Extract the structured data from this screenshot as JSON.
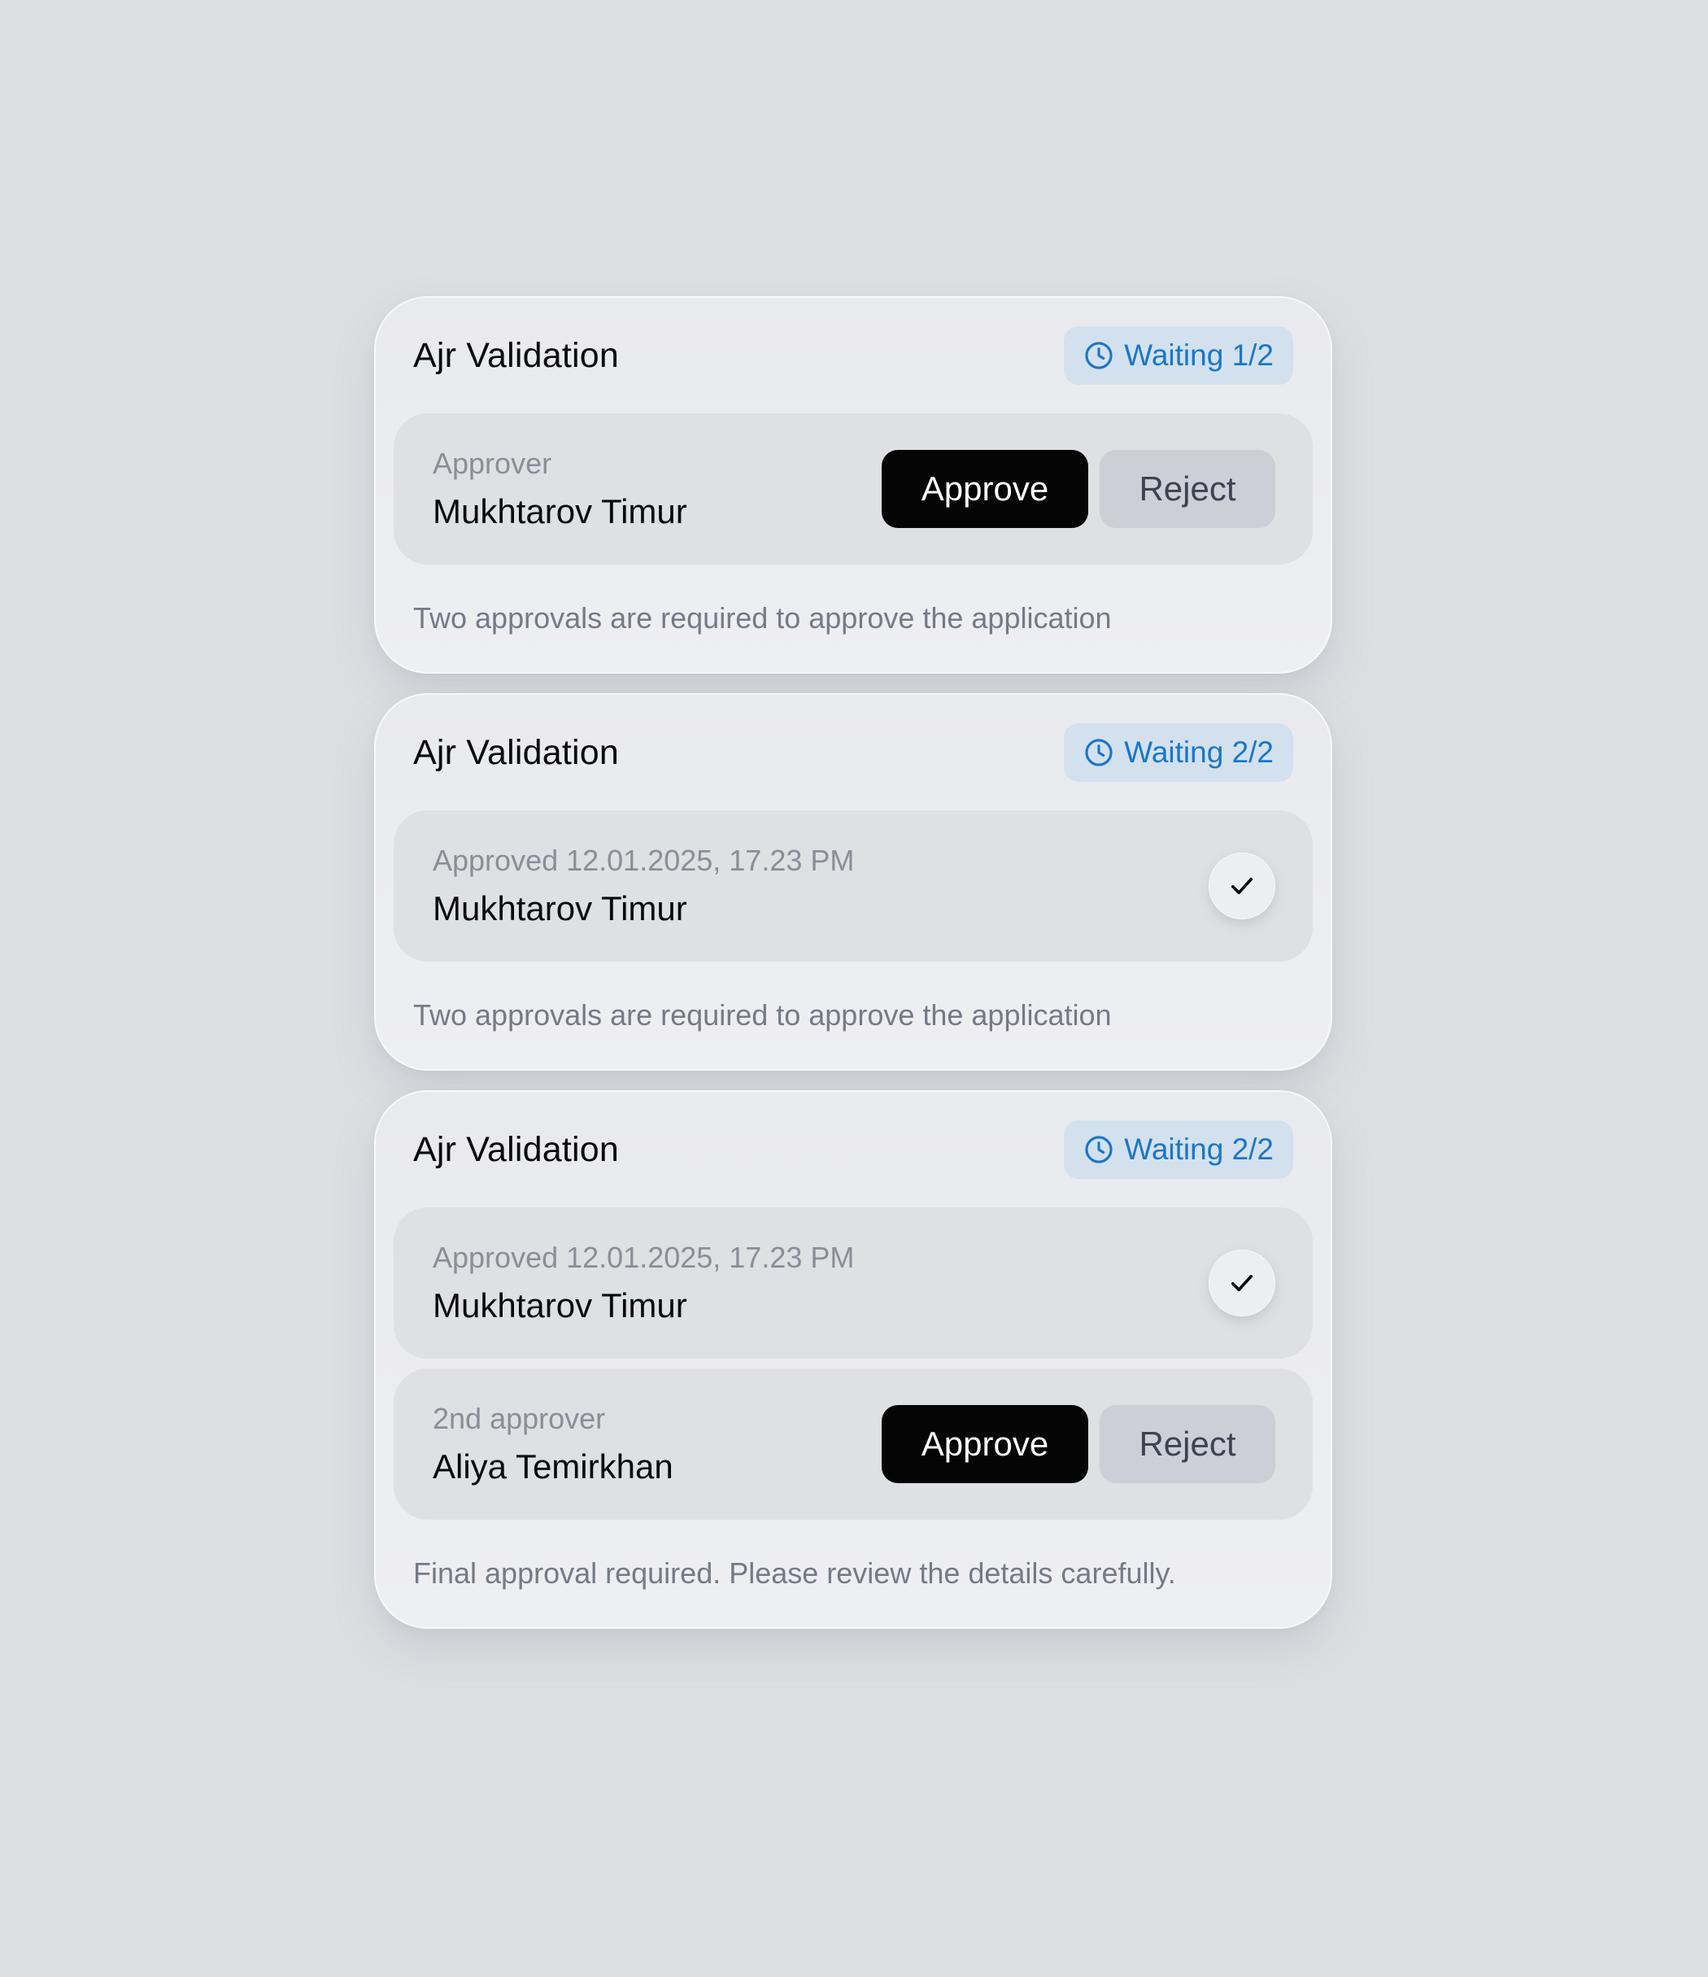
{
  "cards": [
    {
      "title": "Ajr Validation",
      "status": "Waiting 1/2",
      "rows": [
        {
          "caption": "Approver",
          "name": "Mukhtarov Timur",
          "approve_label": "Approve",
          "reject_label": "Reject"
        }
      ],
      "note": "Two approvals are required to approve the application"
    },
    {
      "title": "Ajr Validation",
      "status": "Waiting 2/2",
      "rows": [
        {
          "caption": "Approved 12.01.2025, 17.23 PM",
          "name": "Mukhtarov Timur",
          "icon": "check-icon"
        }
      ],
      "note": "Two approvals are required to approve the application"
    },
    {
      "title": "Ajr Validation",
      "status": "Waiting 2/2",
      "rows": [
        {
          "caption": "Approved 12.01.2025, 17.23 PM",
          "name": "Mukhtarov Timur",
          "icon": "check-icon"
        },
        {
          "caption": "2nd approver",
          "name": "Aliya Temirkhan",
          "approve_label": "Approve",
          "reject_label": "Reject"
        }
      ],
      "note": "Final approval required. Please review the details carefully."
    }
  ],
  "icons": {
    "status": "clock-icon",
    "approved": "check-icon"
  },
  "colors": {
    "background": "#dcdee2",
    "badge_bg": "#d3e1ee",
    "badge_text": "#1a76c8",
    "approve_bg": "#050505",
    "reject_bg": "#ccd0d6"
  }
}
